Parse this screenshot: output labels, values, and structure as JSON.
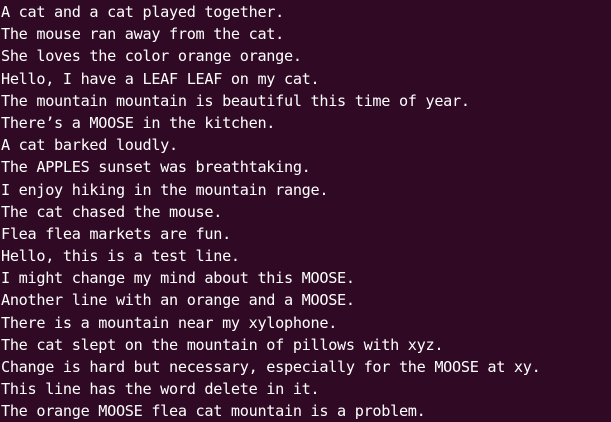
{
  "terminal": {
    "background_color": "#300a24",
    "text_color": "#ffffff",
    "lines": [
      "A cat and a cat played together.",
      "The mouse ran away from the cat.",
      "She loves the color orange orange.",
      "Hello, I have a LEAF LEAF on my cat.",
      "The mountain mountain is beautiful this time of year.",
      "There’s a MOOSE in the kitchen.",
      "A cat barked loudly.",
      "The APPLES sunset was breathtaking.",
      "I enjoy hiking in the mountain range.",
      "The cat chased the mouse.",
      "Flea flea markets are fun.",
      "Hello, this is a test line.",
      "I might change my mind about this MOOSE.",
      "Another line with an orange and a MOOSE.",
      "There is a mountain near my xylophone.",
      "The cat slept on the mountain of pillows with xyz.",
      "Change is hard but necessary, especially for the MOOSE at xy.",
      "This line has the word delete in it.",
      "The orange MOOSE flea cat mountain is a problem."
    ]
  }
}
